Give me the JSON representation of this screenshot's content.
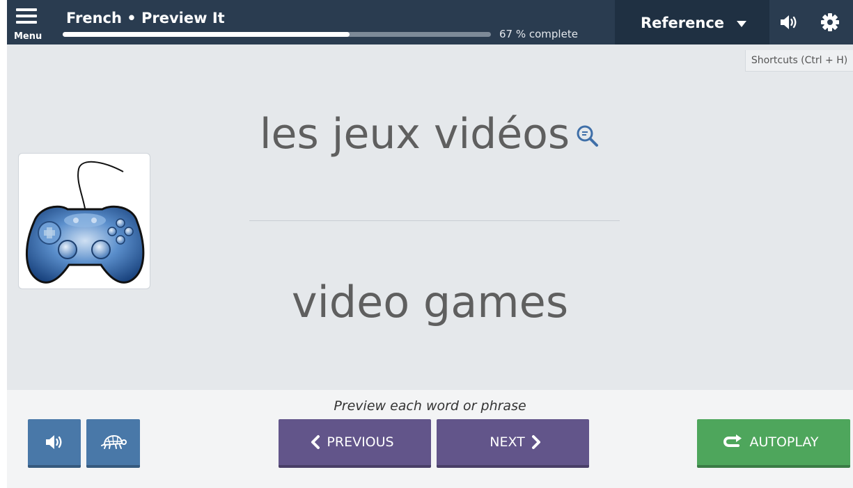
{
  "header": {
    "menu_label": "Menu",
    "title": "French • Preview It",
    "progress_fraction": 0.67,
    "progress_text": "67 % complete",
    "reference_label": "Reference"
  },
  "shortcuts_label": "Shortcuts (Ctrl + H)",
  "card": {
    "word": "les jeux vidéos",
    "translation": "video games",
    "image_icon": "game-controller-icon"
  },
  "footer": {
    "instruction": "Preview each word or phrase",
    "previous_label": "PREVIOUS",
    "next_label": "NEXT",
    "autoplay_label": "AUTOPLAY"
  },
  "colors": {
    "header_bg": "#2a3c50",
    "reference_bg": "#1f3042",
    "content_bg": "#e5e8eb",
    "blue_button": "#4978a8",
    "purple_button": "#62558a",
    "green_button": "#4ea65c"
  },
  "icons": {
    "menu": "hamburger-icon",
    "caret": "caret-down-icon",
    "audio": "speaker-icon",
    "settings": "gear-icon",
    "zoom": "magnifier-icon",
    "slow": "turtle-icon",
    "prev": "chevron-left-icon",
    "next": "chevron-right-icon",
    "autoplay": "loop-arrow-icon"
  }
}
